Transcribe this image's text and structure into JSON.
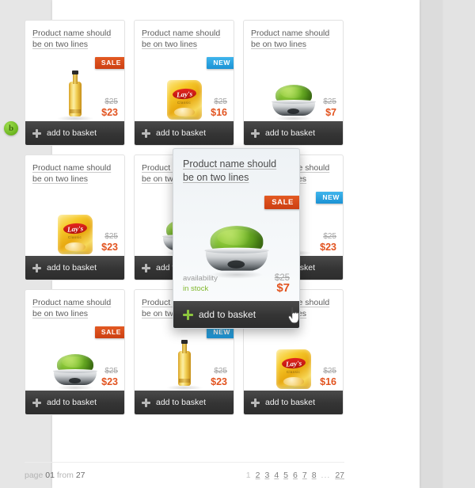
{
  "blob": {
    "label": "b"
  },
  "labels": {
    "add_to_basket": "add to basket",
    "badge_sale": "SALE",
    "badge_new": "NEW",
    "availability_label": "availability",
    "availability_value": "in stock"
  },
  "colors": {
    "sale_badge": "#cc3f12",
    "new_badge": "#1b92d4",
    "price_now": "#e2531f",
    "price_old": "#a6a6a6",
    "in_stock": "#7fb72b",
    "basket_bar": "#343434",
    "plus_green": "#8cc63e",
    "panel_bg": "#ffffff",
    "page_bg": "#e3e3e3"
  },
  "products": [
    {
      "name_line1": "Product name should",
      "name_line2": "be on two lines",
      "image": "beer-bottle-image",
      "badge": "SALE",
      "price_old": "$25",
      "price_now": "$23"
    },
    {
      "name_line1": "Product name should",
      "name_line2": "be on two lines",
      "image": "chips-bag-image",
      "badge": "NEW",
      "price_old": "$25",
      "price_now": "$16"
    },
    {
      "name_line1": "Product name should",
      "name_line2": "be on two lines",
      "image": "salad-bowl-image",
      "badge": "",
      "price_old": "$25",
      "price_now": "$7"
    },
    {
      "name_line1": "Product name should",
      "name_line2": "be on two lines",
      "image": "chips-bag-image",
      "badge": "",
      "price_old": "$25",
      "price_now": "$23"
    },
    {
      "name_line1": "Product name should",
      "name_line2": "be on two lines",
      "image": "salad-bowl-image",
      "badge": "SALE",
      "price_old": "$25",
      "price_now": "$7"
    },
    {
      "name_line1": "Product name should",
      "name_line2": "be on two lines",
      "image": "beer-bottle-image",
      "badge": "NEW",
      "price_old": "$25",
      "price_now": "$23"
    },
    {
      "name_line1": "Product name should",
      "name_line2": "be on two lines",
      "image": "salad-bowl-image",
      "badge": "SALE",
      "price_old": "$25",
      "price_now": "$23"
    },
    {
      "name_line1": "Product name should",
      "name_line2": "be on two lines",
      "image": "beer-bottle-image",
      "badge": "NEW",
      "price_old": "$25",
      "price_now": "$23"
    },
    {
      "name_line1": "Product name should",
      "name_line2": "be on two lines",
      "image": "chips-bag-image",
      "badge": "",
      "price_old": "$25",
      "price_now": "$16"
    }
  ],
  "popup": {
    "name_line1": "Product name should",
    "name_line2": "be on two lines",
    "image": "salad-bowl-image",
    "badge": "SALE",
    "availability_label": "availability",
    "availability_value": "in stock",
    "price_old": "$25",
    "price_now": "$7",
    "add_to_basket": "add to basket"
  },
  "pagination": {
    "page_word": "page",
    "current": "01",
    "from_word": "from",
    "total": "27",
    "pages": [
      "1",
      "2",
      "3",
      "4",
      "5",
      "6",
      "7",
      "8"
    ],
    "ellipsis": "...",
    "last": "27",
    "active_index": 0
  },
  "chips_label": {
    "brand": "Lay's",
    "sub": "Classic"
  }
}
